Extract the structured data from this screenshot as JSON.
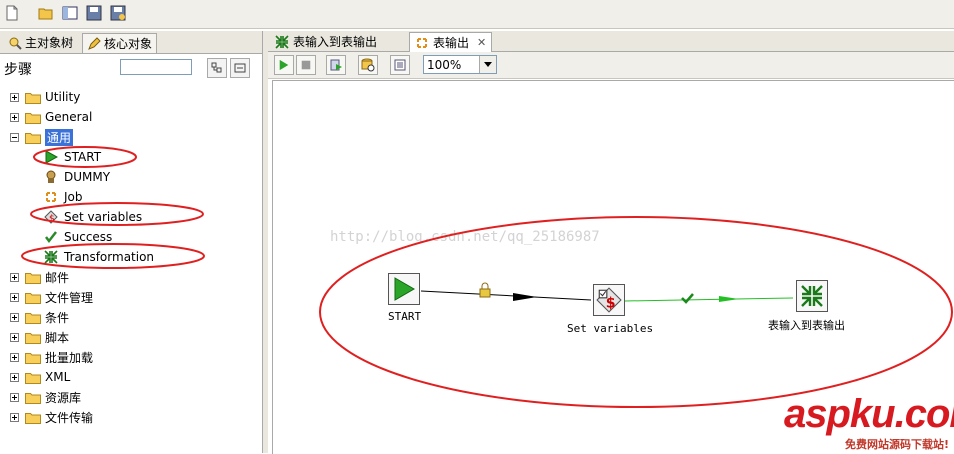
{
  "left_tabs": {
    "main_tree": "主对象树",
    "core_objects": "核心对象"
  },
  "steps_label": "步骤",
  "tree": {
    "categories": [
      "Utility",
      "General",
      "通用",
      "邮件",
      "文件管理",
      "条件",
      "脚本",
      "批量加载",
      "XML",
      "资源库",
      "文件传输"
    ],
    "general_items": [
      "START",
      "DUMMY",
      "Job",
      "Set variables",
      "Success",
      "Transformation"
    ]
  },
  "editor_tabs": {
    "tab1": "表输入到表输出",
    "tab2": "表输出"
  },
  "zoom_value": "100%",
  "canvas": {
    "watermark": "http://blog.csdn.net/qq_25186987",
    "nodes": {
      "start": "START",
      "set_variables": "Set variables",
      "transformation": "表输入到表输出"
    }
  },
  "brand": {
    "logo": "aspku.com",
    "tagline": "免费网站源码下载站!"
  },
  "colors": {
    "selection": "#3a72d8",
    "annotation": "#e02020",
    "hop_ok": "#22c022"
  }
}
